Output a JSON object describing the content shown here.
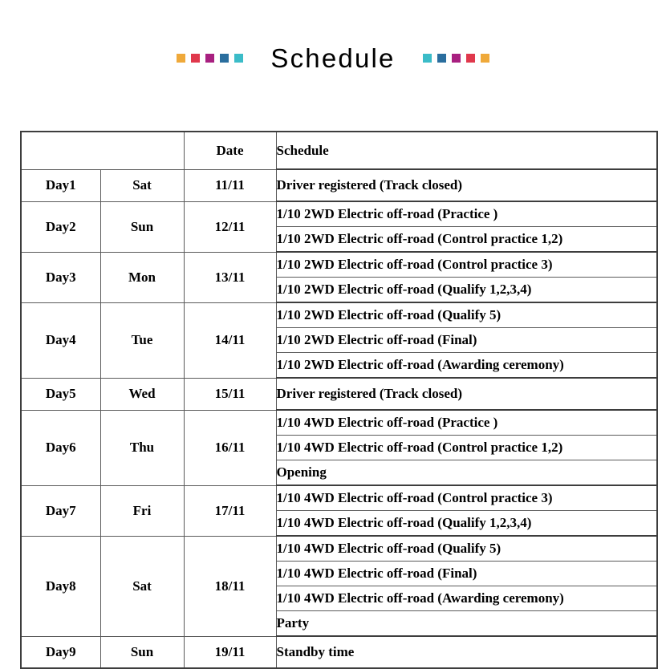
{
  "title": {
    "text": "Schedule",
    "deco_left": [
      "#efa93a",
      "#e0384c",
      "#a82080",
      "#2a6e9e",
      "#3bbcc8"
    ],
    "deco_right": [
      "#3bbcc8",
      "#2a6e9e",
      "#a82080",
      "#e0384c",
      "#efa93a"
    ]
  },
  "table": {
    "headers": {
      "day": "",
      "weekday": "",
      "date": "Date",
      "schedule": "Schedule"
    },
    "rows": [
      {
        "day": "Day1",
        "weekday": "Sat",
        "date": "11/11",
        "events": [
          "Driver registered (Track closed)"
        ]
      },
      {
        "day": "Day2",
        "weekday": "Sun",
        "date": "12/11",
        "events": [
          "1/10 2WD Electric off-road (Practice )",
          "1/10 2WD Electric off-road (Control practice 1,2)"
        ]
      },
      {
        "day": "Day3",
        "weekday": "Mon",
        "date": "13/11",
        "events": [
          "1/10 2WD Electric off-road (Control practice 3)",
          "1/10 2WD Electric off-road (Qualify 1,2,3,4)"
        ]
      },
      {
        "day": "Day4",
        "weekday": "Tue",
        "date": "14/11",
        "events": [
          "1/10 2WD Electric off-road (Qualify 5)",
          "1/10 2WD Electric off-road (Final)",
          "1/10 2WD Electric off-road (Awarding ceremony)"
        ]
      },
      {
        "day": "Day5",
        "weekday": "Wed",
        "date": "15/11",
        "events": [
          "Driver registered (Track closed)"
        ]
      },
      {
        "day": "Day6",
        "weekday": "Thu",
        "date": "16/11",
        "events": [
          "1/10 4WD Electric off-road (Practice )",
          "1/10 4WD Electric off-road (Control practice 1,2)",
          "Opening"
        ]
      },
      {
        "day": "Day7",
        "weekday": "Fri",
        "date": "17/11",
        "events": [
          "1/10 4WD Electric off-road (Control practice 3)",
          "1/10 4WD Electric off-road (Qualify 1,2,3,4)"
        ]
      },
      {
        "day": "Day8",
        "weekday": "Sat",
        "date": "18/11",
        "events": [
          "1/10 4WD Electric off-road (Qualify 5)",
          "1/10 4WD Electric off-road (Final)",
          "1/10 4WD Electric off-road (Awarding ceremony)",
          "Party"
        ]
      },
      {
        "day": "Day9",
        "weekday": "Sun",
        "date": "19/11",
        "events": [
          "Standby time"
        ]
      }
    ]
  }
}
